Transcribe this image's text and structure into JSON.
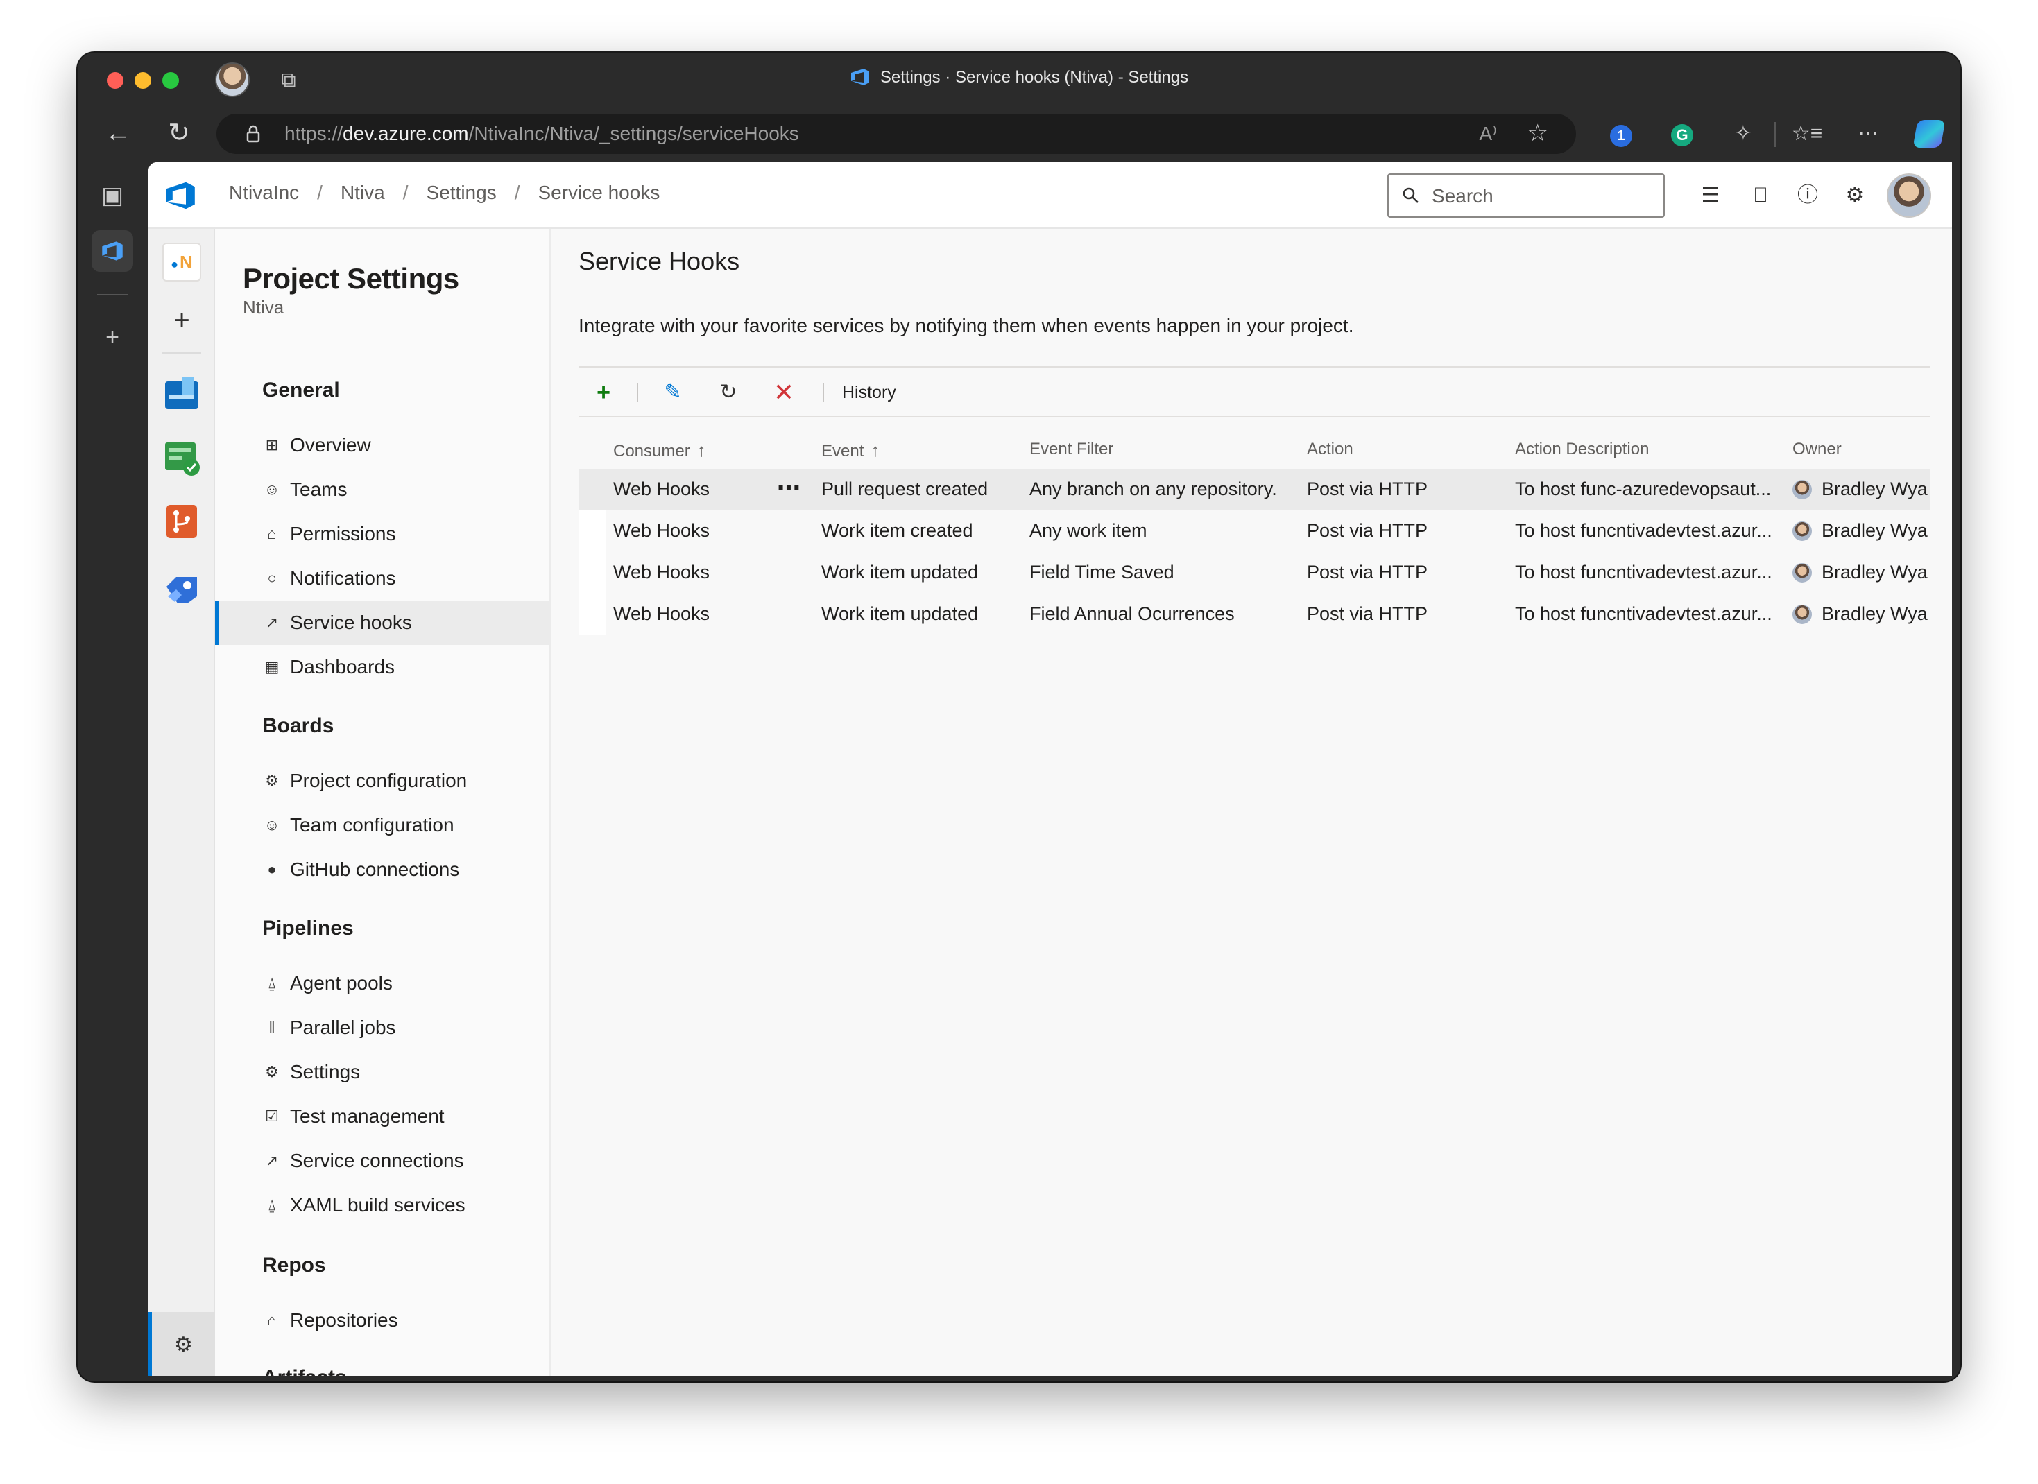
{
  "browser": {
    "window_title": "Settings · Service hooks (Ntiva) - Settings",
    "url_prefix": "https://",
    "url_host": "dev.azure.com",
    "url_path": "/NtivaInc/Ntiva/_settings/serviceHooks",
    "read_aloud": "A⁾"
  },
  "topbar": {
    "breadcrumbs": [
      "NtivaInc",
      "Ntiva",
      "Settings",
      "Service hooks"
    ],
    "separator": "/",
    "search_placeholder": "Search"
  },
  "project_rail": {
    "project_initial": "N"
  },
  "settings_nav": {
    "title": "Project Settings",
    "subtitle": "Ntiva",
    "sections": [
      {
        "heading": "General",
        "items": [
          "Overview",
          "Teams",
          "Permissions",
          "Notifications",
          "Service hooks",
          "Dashboards"
        ]
      },
      {
        "heading": "Boards",
        "items": [
          "Project configuration",
          "Team configuration",
          "GitHub connections"
        ]
      },
      {
        "heading": "Pipelines",
        "items": [
          "Agent pools",
          "Parallel jobs",
          "Settings",
          "Test management",
          "Service connections",
          "XAML build services"
        ]
      },
      {
        "heading": "Repos",
        "items": [
          "Repositories"
        ]
      },
      {
        "heading": "Artifacts",
        "items": []
      }
    ],
    "selected": "Service hooks"
  },
  "main": {
    "title": "Service Hooks",
    "description": "Integrate with your favorite services by notifying them when events happen in your project.",
    "toolbar": {
      "history_label": "History"
    },
    "columns": [
      "Consumer",
      "Event",
      "Event Filter",
      "Action",
      "Action Description",
      "Owner"
    ],
    "rows": [
      {
        "consumer": "Web Hooks",
        "event": "Pull request created",
        "filter": "Any branch on any repository.",
        "action": "Post via HTTP",
        "action_desc": "To host func-azuredevopsaut...",
        "owner": "Bradley Wya"
      },
      {
        "consumer": "Web Hooks",
        "event": "Work item created",
        "filter": "Any work item",
        "action": "Post via HTTP",
        "action_desc": "To host funcntivadevtest.azur...",
        "owner": "Bradley Wya"
      },
      {
        "consumer": "Web Hooks",
        "event": "Work item updated",
        "filter": "Field Time Saved",
        "action": "Post via HTTP",
        "action_desc": "To host funcntivadevtest.azur...",
        "owner": "Bradley Wya"
      },
      {
        "consumer": "Web Hooks",
        "event": "Work item updated",
        "filter": "Field Annual Ocurrences",
        "action": "Post via HTTP",
        "action_desc": "To host funcntivadevtest.azur...",
        "owner": "Bradley Wya"
      }
    ]
  },
  "colors": {
    "accent": "#0078d4",
    "add_green": "#107c10",
    "delete_red": "#d13438",
    "boards_blue": "#0f6cbd",
    "test_plans_green": "#339947",
    "repos_orange": "#e05b2b",
    "pipelines_blue": "#2f6fd8"
  }
}
